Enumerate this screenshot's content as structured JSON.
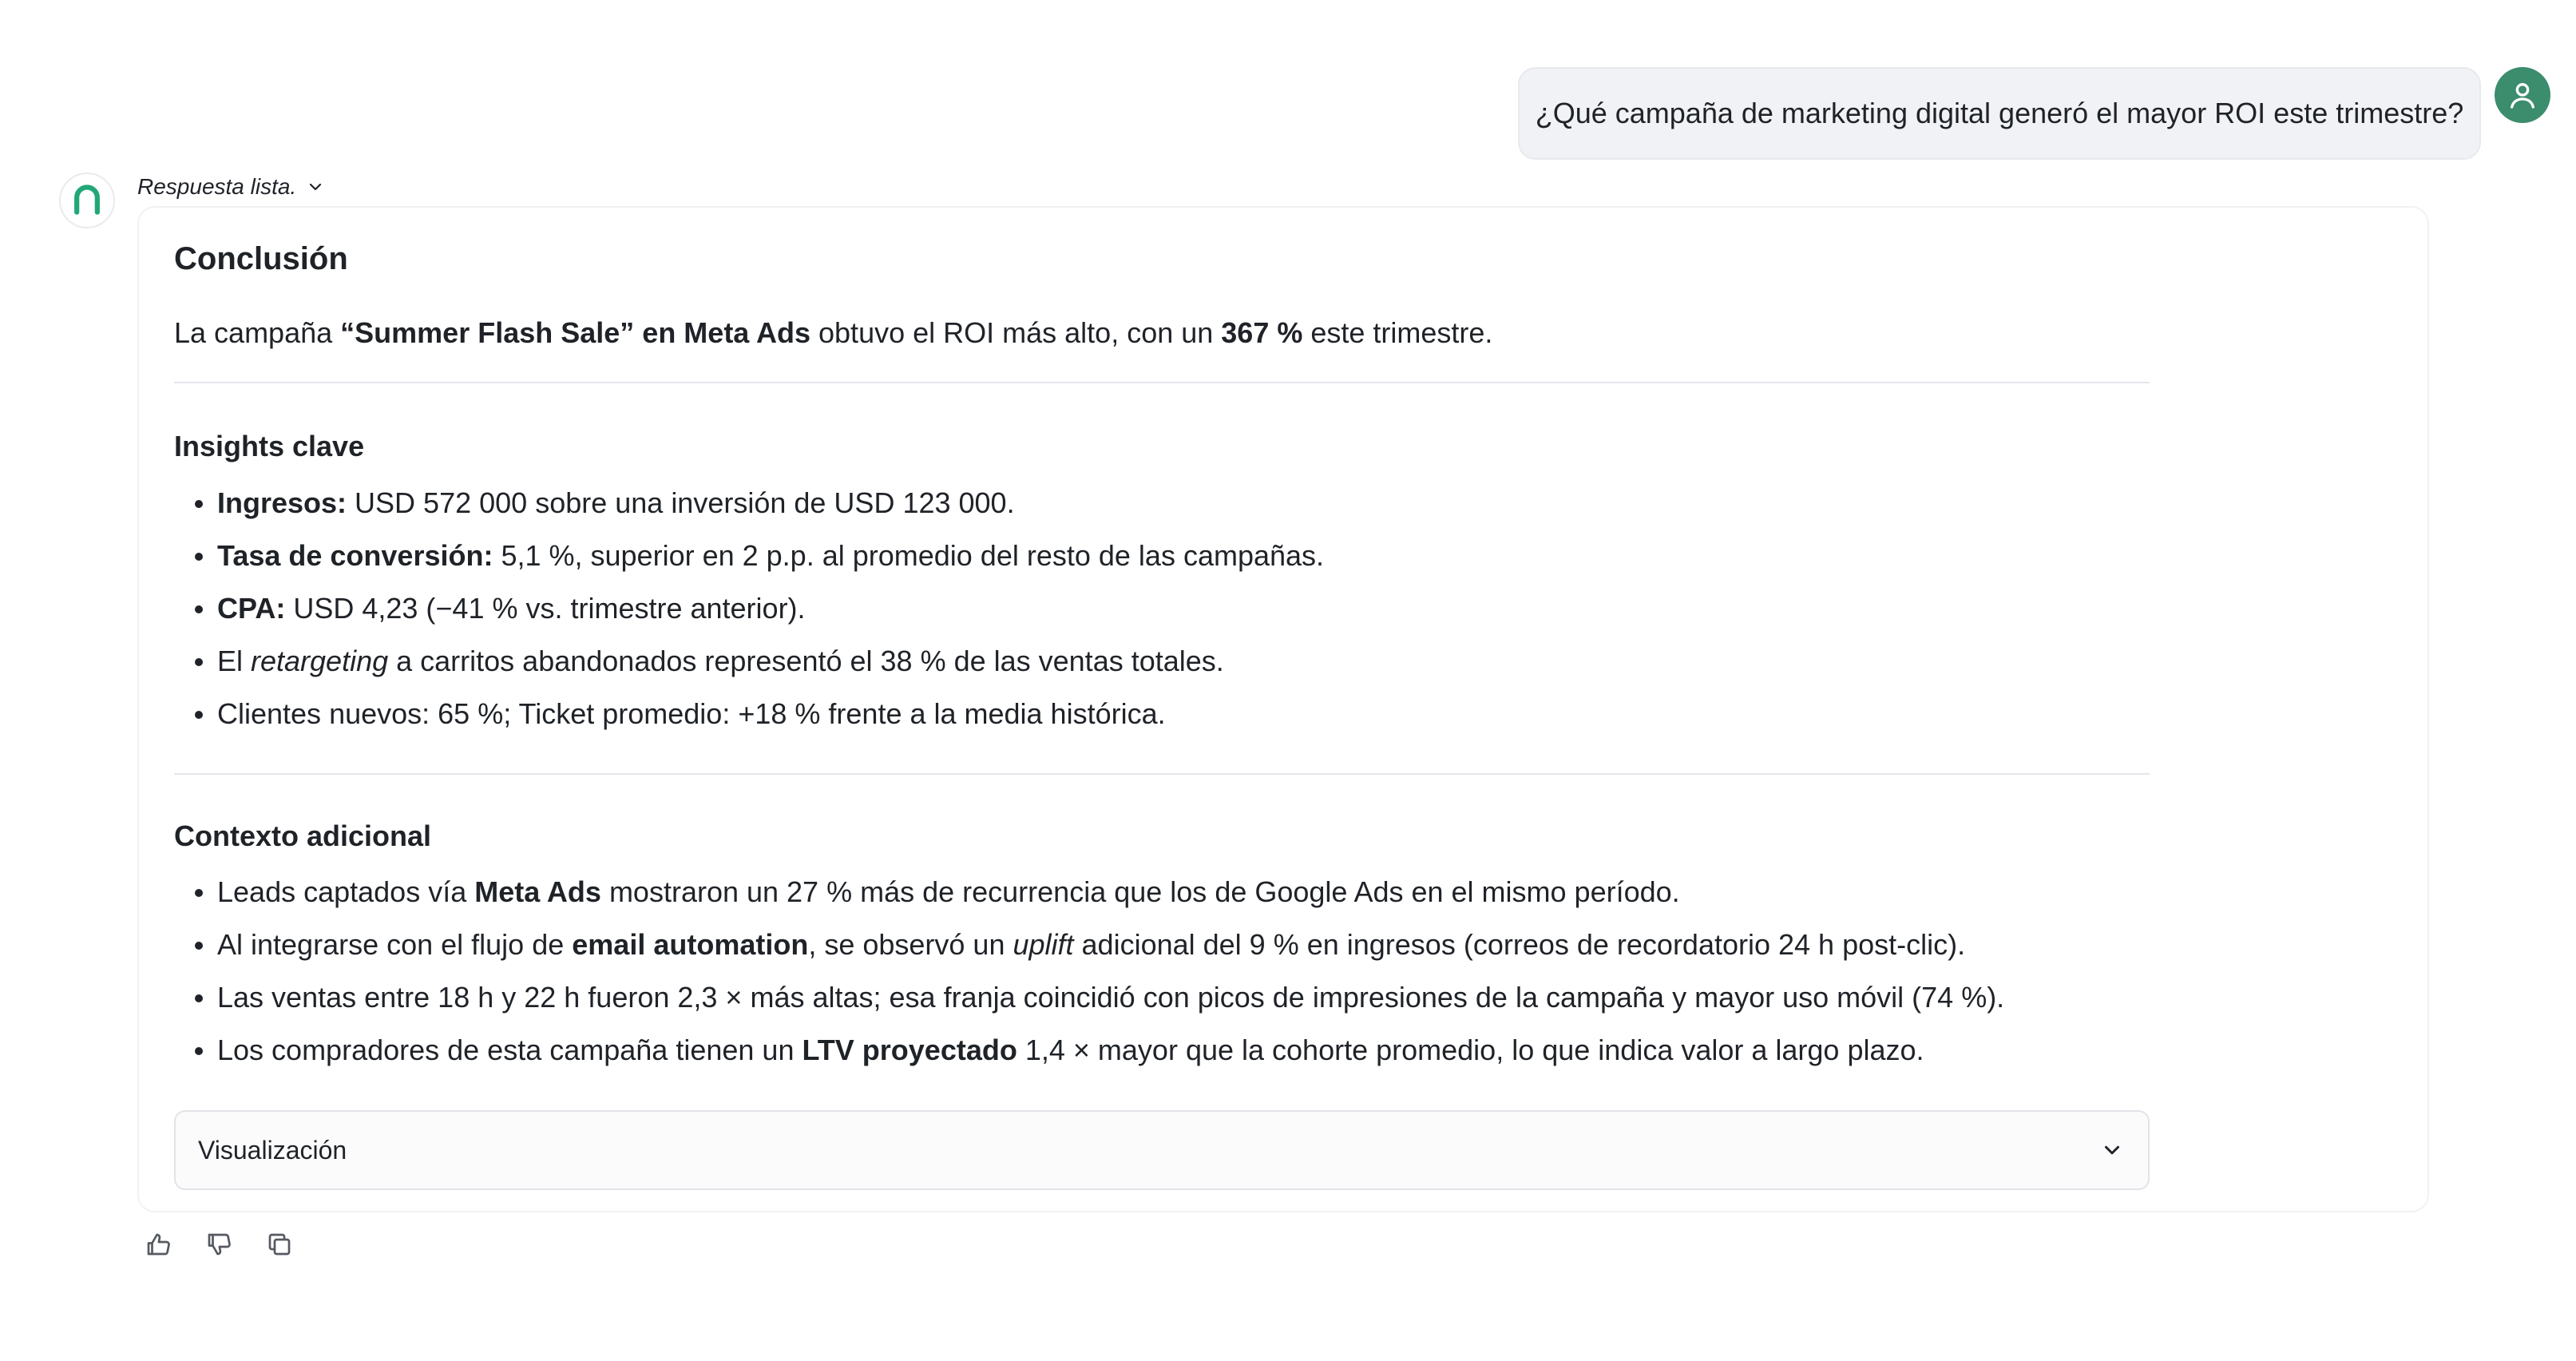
{
  "user_message": {
    "text": "¿Qué campaña de marketing digital generó el mayor ROI este trimestre?"
  },
  "icons": {
    "user_avatar": "user-icon",
    "bot_avatar": "brand-logo-icon",
    "status_chevron": "chevron-down-icon",
    "viz_chevron": "chevron-down-icon",
    "like": "thumbs-up-icon",
    "dislike": "thumbs-down-icon",
    "copy": "copy-icon"
  },
  "colors": {
    "user_avatar_bg": "#3c8c6e",
    "brand_green": "#22a776"
  },
  "assistant": {
    "status": "Respuesta lista.",
    "conclusion": {
      "title": "Conclusión",
      "p1": "La campaña ",
      "p_bold1": "“Summer Flash Sale” en Meta Ads",
      "p2": " obtuvo el ROI más alto, con un ",
      "p_bold2": "367 %",
      "p3": " este trimestre."
    },
    "insights": {
      "title": "Insights clave",
      "items": [
        {
          "bold": "Ingresos:",
          "text": " USD 572 000 sobre una inversión de USD 123 000."
        },
        {
          "bold": "Tasa de conversión:",
          "text": " 5,1 %, superior en 2 p.p. al promedio del resto de las campañas."
        },
        {
          "bold": "CPA:",
          "text": " USD 4,23 (−41 % vs. trimestre anterior)."
        },
        {
          "pre": "El ",
          "italic": "retargeting",
          "text": " a carritos abandonados representó el 38 % de las ventas totales."
        },
        {
          "text": "Clientes nuevos: 65 %; Ticket promedio: +18 % frente a la media histórica."
        }
      ]
    },
    "context": {
      "title": "Contexto adicional",
      "items": [
        {
          "pre": "Leads captados vía ",
          "bold": "Meta Ads",
          "text": " mostraron un 27 % más de recurrencia que los de Google Ads en el mismo período."
        },
        {
          "pre": "Al integrarse con el flujo de ",
          "bold": "email automation",
          "mid": ", se observó un ",
          "italic": "uplift",
          "text": " adicional del 9 % en ingresos (correos de recordatorio 24 h post-clic)."
        },
        {
          "text": "Las ventas entre 18 h y 22 h fueron 2,3 × más altas; esa franja coincidió con picos de impresiones de la campaña y mayor uso móvil (74 %)."
        },
        {
          "pre": "Los compradores de esta campaña tienen un ",
          "bold": "LTV proyectado",
          "text": " 1,4 × mayor que la cohorte promedio, lo que indica valor a largo plazo."
        }
      ]
    },
    "visualization": {
      "label": "Visualización"
    }
  }
}
